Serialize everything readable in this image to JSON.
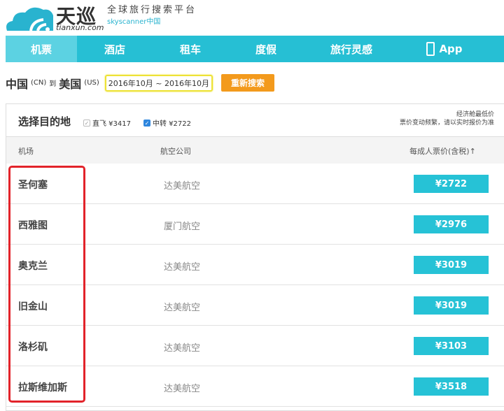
{
  "brand": {
    "name": "天巡",
    "domain": "tianxun.com",
    "tagline": "全球旅行搜索平台",
    "sub": "skyscanner中国"
  },
  "nav": [
    {
      "label": "机票"
    },
    {
      "label": "酒店"
    },
    {
      "label": "租车"
    },
    {
      "label": "度假"
    },
    {
      "label": "旅行灵感"
    },
    {
      "label": "App"
    }
  ],
  "search": {
    "from": "中国",
    "from_code": "(CN)",
    "to_word": "到",
    "to": "美国",
    "to_code": "(US)",
    "date": "2016年10月 ~ 2016年10月",
    "button": "重新搜索"
  },
  "panel": {
    "title": "选择目的地",
    "direct": "直飞 ¥3417",
    "transfer": "中转 ¥2722",
    "note1": "经济舱最低价",
    "note2": "票价变动频繁，请以实时报价为准"
  },
  "columns": {
    "airport": "机场",
    "airline": "航空公司",
    "price": "每成人票价(含税)↑"
  },
  "rows": [
    {
      "city": "圣何塞",
      "airline": "达美航空",
      "price": "¥2722"
    },
    {
      "city": "西雅图",
      "airline": "厦门航空",
      "price": "¥2976"
    },
    {
      "city": "奥克兰",
      "airline": "达美航空",
      "price": "¥3019"
    },
    {
      "city": "旧金山",
      "airline": "达美航空",
      "price": "¥3019"
    },
    {
      "city": "洛杉矶",
      "airline": "达美航空",
      "price": "¥3103"
    },
    {
      "city": "拉斯维加斯",
      "airline": "达美航空",
      "price": "¥3518"
    }
  ]
}
